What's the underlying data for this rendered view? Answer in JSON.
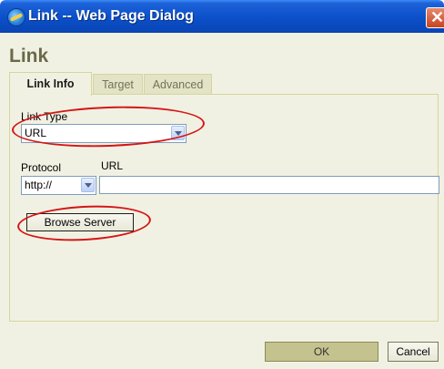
{
  "window": {
    "title": "Link -- Web Page Dialog",
    "close_symbol": "✕",
    "icon": "ie-globe-icon"
  },
  "dialog": {
    "heading": "Link"
  },
  "tabs": [
    {
      "label": "Link Info",
      "active": true
    },
    {
      "label": "Target",
      "active": false
    },
    {
      "label": "Advanced",
      "active": false
    }
  ],
  "link_info": {
    "link_type_label": "Link Type",
    "link_type_value": "URL",
    "protocol_label": "Protocol",
    "protocol_value": "http://",
    "url_label": "URL",
    "url_value": "",
    "browse_server_label": "Browse Server"
  },
  "footer": {
    "ok_label": "OK",
    "cancel_label": "Cancel"
  },
  "colors": {
    "titlebar": "#0b4fc9",
    "dialog_background": "#f1f1e3",
    "highlight_ring": "#d41616"
  }
}
